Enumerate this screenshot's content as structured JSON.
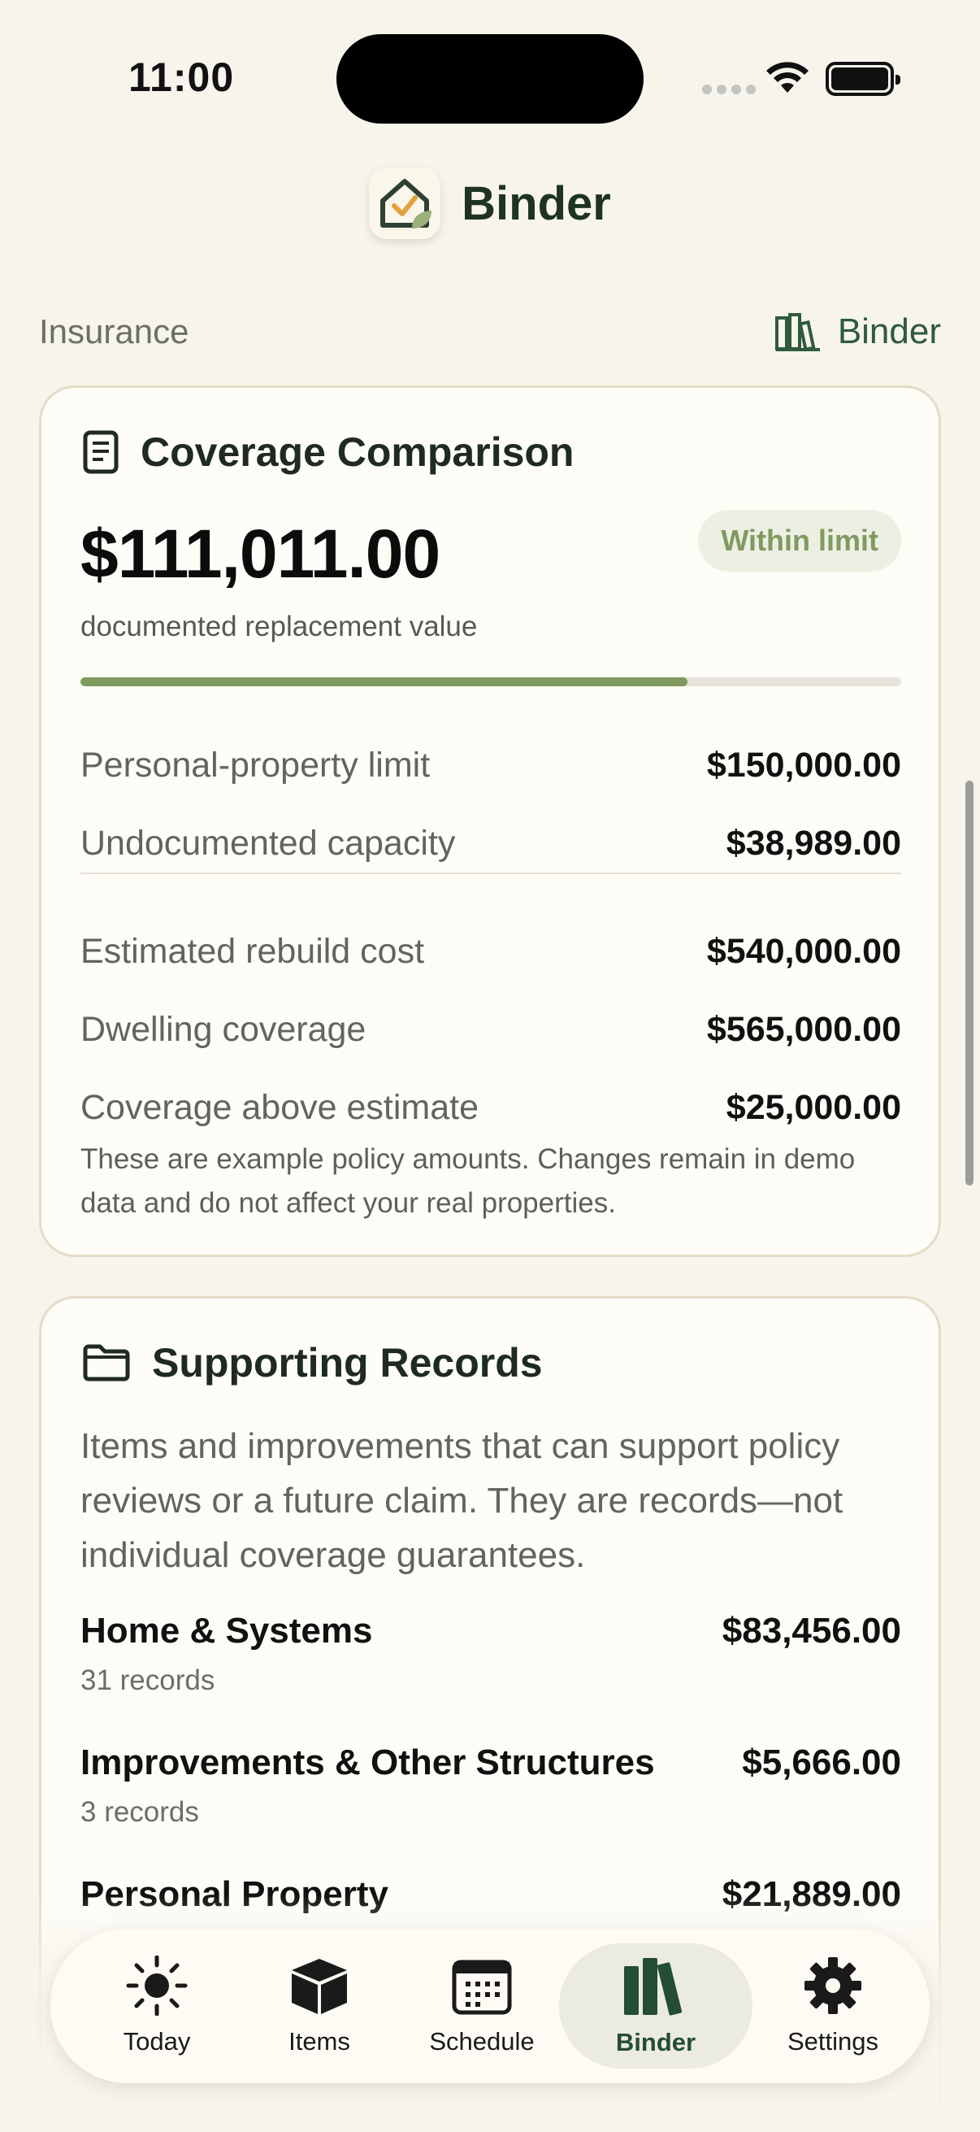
{
  "status_bar": {
    "time": "11:00"
  },
  "app": {
    "title": "Binder"
  },
  "section": {
    "label": "Insurance",
    "link_label": "Binder"
  },
  "coverage": {
    "title": "Coverage Comparison",
    "total_value": "$111,011.00",
    "badge": "Within limit",
    "subtext": "documented replacement value",
    "progress_fraction": 0.74,
    "rows": [
      {
        "label": "Personal-property limit",
        "value": "$150,000.00"
      },
      {
        "label": "Undocumented capacity",
        "value": "$38,989.00"
      },
      {
        "label": "Estimated rebuild cost",
        "value": "$540,000.00"
      },
      {
        "label": "Dwelling coverage",
        "value": "$565,000.00"
      },
      {
        "label": "Coverage above estimate",
        "value": "$25,000.00"
      }
    ],
    "note": "These are example policy amounts. Changes remain in demo data and do not affect your real properties."
  },
  "supporting": {
    "title": "Supporting Records",
    "intro": "Items and improvements that can support policy reviews or a future claim. They are records—not individual coverage guarantees.",
    "records": [
      {
        "name": "Home & Systems",
        "value": "$83,456.00",
        "count": "31 records"
      },
      {
        "name": "Improvements & Other Structures",
        "value": "$5,666.00",
        "count": "3 records"
      },
      {
        "name": "Personal Property",
        "value": "$21,889.00",
        "count": ""
      }
    ]
  },
  "tabs": [
    {
      "label": "Today",
      "icon": "sun-icon"
    },
    {
      "label": "Items",
      "icon": "box-icon"
    },
    {
      "label": "Schedule",
      "icon": "calendar-icon"
    },
    {
      "label": "Binder",
      "icon": "books-icon",
      "active": true
    },
    {
      "label": "Settings",
      "icon": "gear-icon"
    }
  ],
  "colors": {
    "accent": "#2f5a3c",
    "progress": "#7f9a5f",
    "badge_text": "#7f9a62",
    "background": "#f7f4ec"
  }
}
